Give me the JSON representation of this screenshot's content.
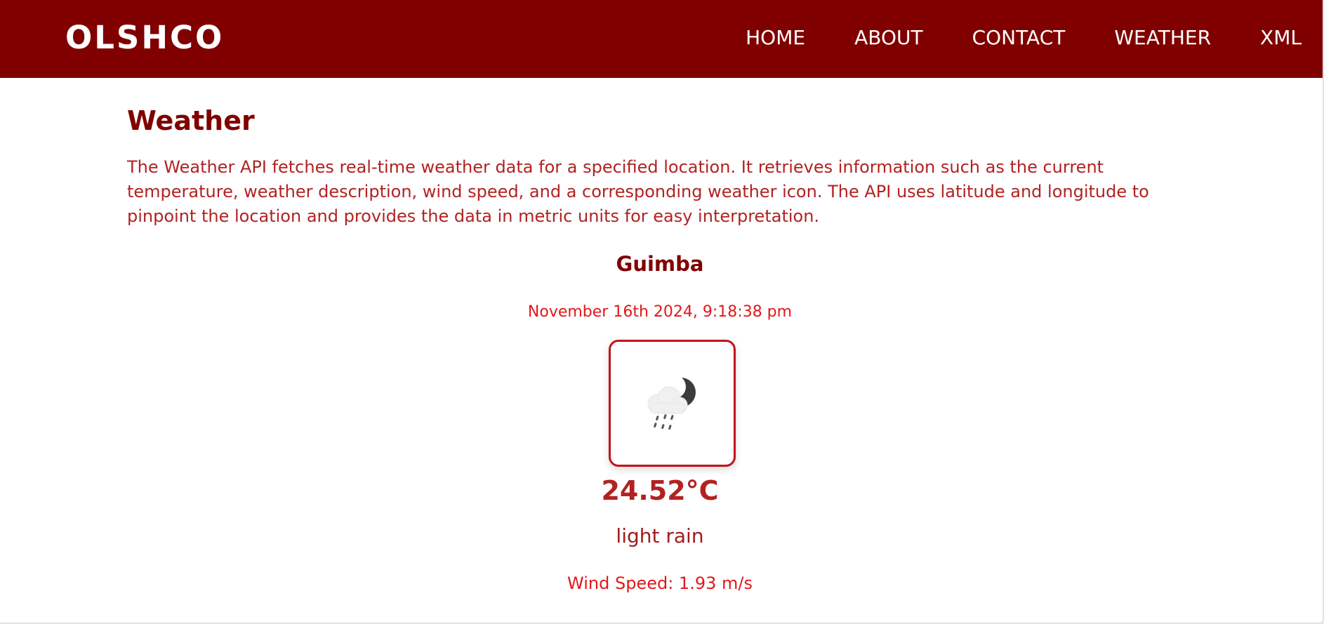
{
  "navbar": {
    "brand": "OLSHCO",
    "links": [
      {
        "label": "HOME"
      },
      {
        "label": "ABOUT"
      },
      {
        "label": "CONTACT"
      },
      {
        "label": "WEATHER"
      },
      {
        "label": "XML"
      }
    ]
  },
  "main": {
    "title": "Weather",
    "intro": "The Weather API fetches real-time weather data for a specified location. It retrieves information such as the current temperature, weather description, wind speed, and a corresponding weather icon. The API uses latitude and longitude to pinpoint the location and provides the data in metric units for easy interpretation."
  },
  "weather": {
    "city": "Guimba",
    "datetime": "November 16th 2024, 9:18:38 pm",
    "icon": "cloud-moon-rain-icon",
    "temperature": "24.52°C",
    "description": "light rain",
    "wind": "Wind Speed: 1.93 m/s"
  },
  "colors": {
    "navbar_bg": "#800000",
    "title": "#800000",
    "text_red": "#b22222",
    "accent_red": "#e3171b",
    "icon_border": "#c0141b"
  }
}
